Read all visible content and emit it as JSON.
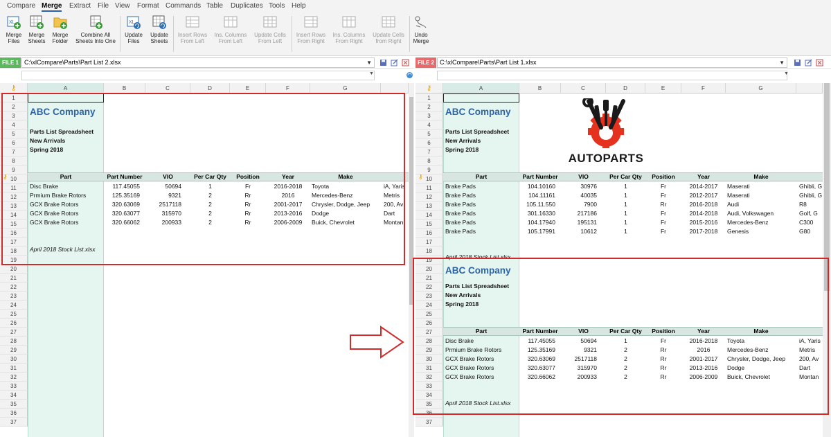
{
  "menu": [
    "Compare",
    "Merge",
    "Extract",
    "File",
    "View",
    "Format",
    "Commands",
    "Table",
    "Duplicates",
    "Tools",
    "Help"
  ],
  "menu_active": "Merge",
  "ribbon": {
    "merge_files": [
      "Merge",
      "Files"
    ],
    "merge_sheets": [
      "Merge",
      "Sheets"
    ],
    "merge_folder": [
      "Merge",
      "Folder"
    ],
    "combine_all": [
      "Combine All",
      "Sheets Into One"
    ],
    "update_files": [
      "Update",
      "Files"
    ],
    "update_sheets": [
      "Update",
      "Sheets"
    ],
    "insert_rows_left": [
      "Insert Rows",
      "From Left"
    ],
    "ins_columns_left": [
      "Ins. Columns",
      "From Left"
    ],
    "update_cells_left": [
      "Update Cells",
      "From Left"
    ],
    "insert_rows_right": [
      "Insert Rows",
      "From Right"
    ],
    "ins_columns_right": [
      "Ins. Columns",
      "From Right"
    ],
    "update_cells_right": [
      "Update Cells",
      "from Right"
    ],
    "undo_merge": [
      "Undo",
      "Merge"
    ]
  },
  "colors": {
    "file1": "#5cb85c",
    "file2": "#e8696b",
    "accent": "#2d64a8",
    "highlight": "#d12a2a"
  },
  "columns": [
    "A",
    "B",
    "C",
    "D",
    "E",
    "F",
    "G"
  ],
  "left": {
    "file_label": "FILE 1",
    "path": "C:\\xlCompare\\Parts\\Part List 2.xlsx",
    "company": "ABC Company",
    "sub1": "Parts List Spreadsheet",
    "sub2": "New Arrivals",
    "sub3": "Spring 2018",
    "headers": [
      "Part",
      "Part Number",
      "VIO",
      "Per Car Qty",
      "Position",
      "Year",
      "Make"
    ],
    "rows": [
      [
        "Disc Brake",
        "117.45055",
        "50694",
        "1",
        "Fr",
        "2016-2018",
        "Toyota",
        "iA, Yaris"
      ],
      [
        "Prmium Brake Rotors",
        "125.35169",
        "9321",
        "2",
        "Rr",
        "2016",
        "Mercedes-Benz",
        "Metris"
      ],
      [
        "GCX Brake Rotors",
        "320.63069",
        "2517118",
        "2",
        "Rr",
        "2001-2017",
        "Chrysler, Dodge, Jeep",
        "200, Av"
      ],
      [
        "GCX Brake Rotors",
        "320.63077",
        "315970",
        "2",
        "Rr",
        "2013-2016",
        "Dodge",
        "Dart"
      ],
      [
        "GCX Brake Rotors",
        "320.66062",
        "200933",
        "2",
        "Rr",
        "2006-2009",
        "Buick, Chevrolet",
        "Montan"
      ]
    ],
    "footer": "April 2018 Stock List.xlsx",
    "row_numbers": [
      "1",
      "2",
      "3",
      "4",
      "5",
      "6",
      "7",
      "8",
      "9",
      "10",
      "11",
      "12",
      "13",
      "14",
      "15",
      "16",
      "17",
      "18",
      "19",
      "20",
      "21",
      "22",
      "23",
      "24",
      "25",
      "26",
      "27",
      "28",
      "29",
      "30",
      "31",
      "32",
      "33",
      "34",
      "35",
      "36",
      "37"
    ]
  },
  "right": {
    "file_label": "FILE 2",
    "path": "C:\\xlCompare\\Parts\\Part List 1.xlsx",
    "company": "ABC Company",
    "sub1": "Parts List Spreadsheet",
    "sub2": "New Arrivals",
    "sub3": "Spring 2018",
    "logo_text": "AUTOPARTS",
    "headers": [
      "Part",
      "Part Number",
      "VIO",
      "Per Car Qty",
      "Position",
      "Year",
      "Make"
    ],
    "rows": [
      [
        "Brake Pads",
        "104.10160",
        "30976",
        "1",
        "Fr",
        "2014-2017",
        "Maserati",
        "Ghibli, G"
      ],
      [
        "Brake Pads",
        "104.11161",
        "40035",
        "1",
        "Fr",
        "2012-2017",
        "Maserati",
        "Ghibli, G"
      ],
      [
        "Brake Pads",
        "105.11.550",
        "7900",
        "1",
        "Rr",
        "2016-2018",
        "Audi",
        "R8"
      ],
      [
        "Brake Pads",
        "301.16330",
        "217186",
        "1",
        "Fr",
        "2014-2018",
        "Audi, Volkswagen",
        "Golf, G"
      ],
      [
        "Brake Pads",
        "104.17940",
        "195131",
        "1",
        "Fr",
        "2015-2016",
        "Mercedes-Benz",
        "C300"
      ],
      [
        "Brake Pads",
        "105.17991",
        "10612",
        "1",
        "Fr",
        "2017-2018",
        "Genesis",
        "G80"
      ]
    ],
    "footer_partial": "April 2018 Stock List.xlsx",
    "company2": "ABC Company",
    "sub1b": "Parts List Spreadsheet",
    "sub2b": "New Arrivals",
    "sub3b": "Spring 2018",
    "headers2": [
      "Part",
      "Part Number",
      "VIO",
      "Per Car Qty",
      "Position",
      "Year",
      "Make"
    ],
    "rows2": [
      [
        "Disc Brake",
        "117.45055",
        "50694",
        "1",
        "Fr",
        "2016-2018",
        "Toyota",
        "iA, Yaris"
      ],
      [
        "Prmium Brake Rotors",
        "125.35169",
        "9321",
        "2",
        "Rr",
        "2016",
        "Mercedes-Benz",
        "Metris"
      ],
      [
        "GCX Brake Rotors",
        "320.63069",
        "2517118",
        "2",
        "Rr",
        "2001-2017",
        "Chrysler, Dodge, Jeep",
        "200, Av"
      ],
      [
        "GCX Brake Rotors",
        "320.63077",
        "315970",
        "2",
        "Rr",
        "2013-2016",
        "Dodge",
        "Dart"
      ],
      [
        "GCX Brake Rotors",
        "320.66062",
        "200933",
        "2",
        "Rr",
        "2006-2009",
        "Buick, Chevrolet",
        "Montan"
      ]
    ],
    "footer2": "April 2018 Stock List.xlsx",
    "row_numbers": [
      "1",
      "2",
      "3",
      "4",
      "5",
      "6",
      "7",
      "8",
      "9",
      "10",
      "11",
      "12",
      "13",
      "14",
      "15",
      "16",
      "17",
      "18",
      "19",
      "20",
      "21",
      "22",
      "23",
      "24",
      "25",
      "26",
      "27",
      "28",
      "29",
      "30",
      "31",
      "32",
      "33",
      "34",
      "35",
      "36",
      "37"
    ]
  }
}
